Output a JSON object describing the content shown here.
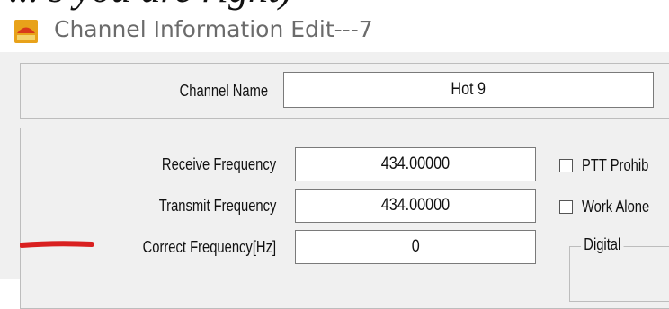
{
  "overlay_text": "... s you are right)",
  "window": {
    "title": "Channel Information Edit---7",
    "icon": "app-window-icon"
  },
  "channel": {
    "name_label": "Channel Name",
    "name_value": "Hot 9"
  },
  "frequency": {
    "receive_label": "Receive Frequency",
    "receive_value": "434.00000",
    "transmit_label": "Transmit Frequency",
    "transmit_value": "434.00000",
    "correct_label": "Correct Frequency[Hz]",
    "correct_value": "0"
  },
  "options": {
    "ptt_prohibit_label": "PTT Prohib",
    "ptt_prohibit_checked": false,
    "work_alone_label": "Work Alone",
    "work_alone_checked": false,
    "digital_group_label": "Digital"
  },
  "annotation": {
    "color": "#d92020"
  }
}
